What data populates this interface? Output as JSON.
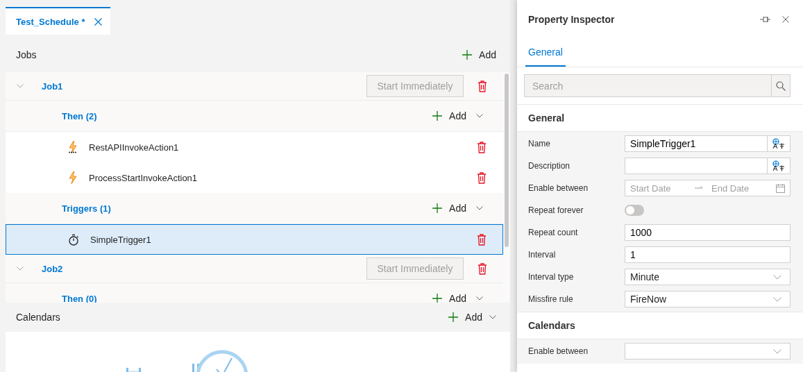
{
  "tabs": [
    {
      "label": "Test_Schedule *",
      "selected": true
    }
  ],
  "jobs_panel": {
    "title": "Jobs",
    "add_label": "Add"
  },
  "jobs": [
    {
      "name": "Job1",
      "start_label": "Start Immediately",
      "start_disabled": true,
      "groups": [
        {
          "label": "Then (2)",
          "add_label": "Add",
          "items": [
            {
              "kind": "rest-action",
              "name": "RestAPIInvokeAction1",
              "selected": false
            },
            {
              "kind": "process-action",
              "name": "ProcessStartInvokeAction1",
              "selected": false
            }
          ]
        },
        {
          "label": "Triggers (1)",
          "add_label": "Add",
          "items": [
            {
              "kind": "timer-trigger",
              "name": "SimpleTrigger1",
              "selected": true
            }
          ]
        }
      ]
    },
    {
      "name": "Job2",
      "start_label": "Start Immediately",
      "start_disabled": true,
      "groups": [
        {
          "label": "Then (0)",
          "add_label": "Add"
        }
      ]
    }
  ],
  "calendars_panel": {
    "title": "Calendars",
    "add_label": "Add"
  },
  "inspector": {
    "title": "Property Inspector",
    "tabs": [
      {
        "label": "General",
        "selected": true
      }
    ],
    "search": {
      "placeholder": "Search"
    },
    "sections": [
      {
        "title": "General",
        "rows": [
          {
            "kind": "localized-text",
            "label": "Name",
            "value": "SimpleTrigger1"
          },
          {
            "kind": "localized-text",
            "label": "Description"
          },
          {
            "kind": "date-range",
            "label": "Enable between",
            "start_placeholder": "Start Date",
            "end_placeholder": "End Date"
          },
          {
            "kind": "toggle",
            "label": "Repeat forever",
            "on": false
          },
          {
            "kind": "text",
            "label": "Repeat count",
            "value": "1000"
          },
          {
            "kind": "text",
            "label": "Interval",
            "value": "1"
          },
          {
            "kind": "dropdown",
            "label": "Interval type",
            "value": "Minute"
          },
          {
            "kind": "dropdown",
            "label": "Missfire rule",
            "value": "FireNow"
          }
        ]
      },
      {
        "title": "Calendars",
        "rows": [
          {
            "kind": "dropdown",
            "label": "Enable between"
          }
        ]
      }
    ]
  }
}
